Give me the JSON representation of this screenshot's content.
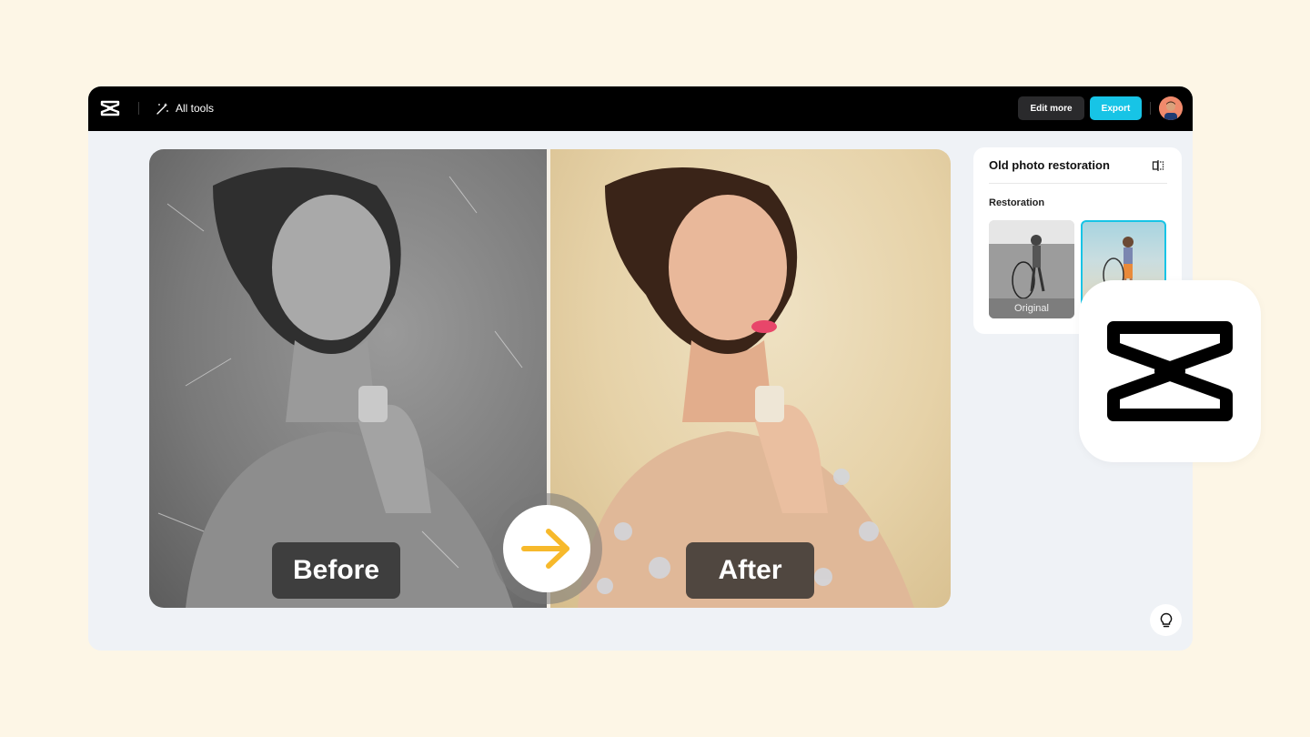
{
  "topbar": {
    "all_tools_label": "All tools",
    "edit_more_label": "Edit more",
    "export_label": "Export"
  },
  "compare": {
    "before_label": "Before",
    "after_label": "After"
  },
  "panel": {
    "title": "Old photo restoration",
    "section_label": "Restoration",
    "original_caption": "Original"
  },
  "colors": {
    "accent": "#17c4e6",
    "arrow": "#f7b92b",
    "page_bg": "#fdf6e6",
    "topbar_bg": "#000000"
  },
  "icons": {
    "logo": "capcut-logo-icon",
    "tools": "magic-wand-icon",
    "compare": "compare-icon",
    "arrow": "arrow-right-icon",
    "tip": "lightbulb-icon"
  }
}
